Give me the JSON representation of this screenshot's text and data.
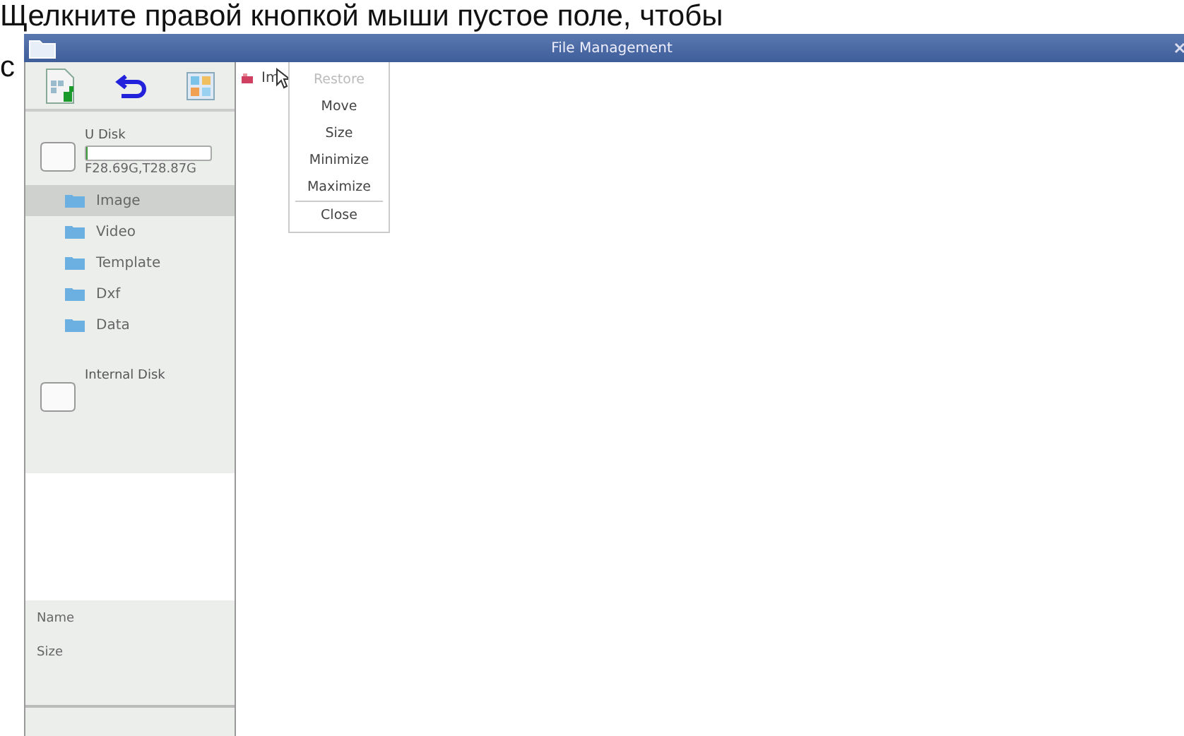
{
  "caption": {
    "line_1": "Щелкните правой кнопкой мыши пустое поле, чтобы",
    "line_2_start": "с"
  },
  "window": {
    "title": "File Management"
  },
  "disks": [
    {
      "name": "U Disk",
      "level": 0.01,
      "space": "F28.69G,T28.87G",
      "folders": [
        {
          "name": "Image",
          "selected": true
        },
        {
          "name": "Video",
          "selected": false
        },
        {
          "name": "Template",
          "selected": false
        },
        {
          "name": "Dxf",
          "selected": false
        },
        {
          "name": "Data",
          "selected": false
        }
      ]
    },
    {
      "name": "Internal Disk"
    }
  ],
  "details": [
    "Name",
    "Size"
  ],
  "files": [
    {
      "name": "Im"
    }
  ],
  "context_menu": [
    {
      "label": "Restore",
      "disabled": true,
      "separator_before": false
    },
    {
      "label": "Move",
      "disabled": false,
      "separator_before": false
    },
    {
      "label": "Size",
      "disabled": false,
      "separator_before": false
    },
    {
      "label": "Minimize",
      "disabled": false,
      "separator_before": false
    },
    {
      "label": "Maximize",
      "disabled": false,
      "separator_before": false
    },
    {
      "label": "Close",
      "disabled": false,
      "separator_before": true
    }
  ]
}
